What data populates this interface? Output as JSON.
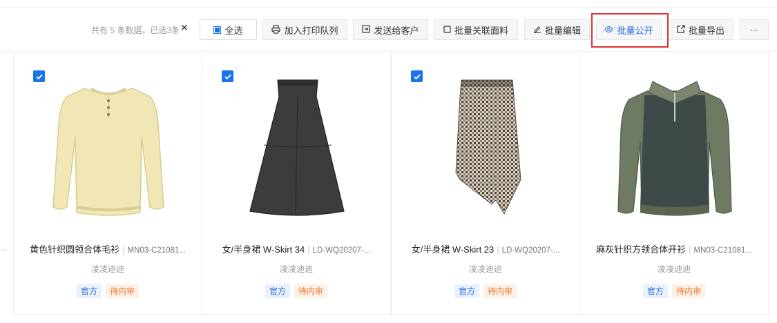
{
  "toolbar": {
    "count_text": "共有 5 条数据，已选3条",
    "clear_icon": "✕",
    "select_all": "全选",
    "add_print": "加入打印队列",
    "send_customer": "发送给客户",
    "batch_link_fabric": "批量关联面料",
    "batch_edit": "批量编辑",
    "batch_publish": "批量公开",
    "batch_export": "批量导出",
    "more": "···"
  },
  "colors": {
    "accent": "#1a73e8",
    "highlight_border": "#e0302f",
    "tag_blue_text": "#2a6be0",
    "tag_orange_text": "#f07a30"
  },
  "left_stub": {
    "dots": "..."
  },
  "cards": [
    {
      "name": "黄色针织圆领合体毛衫",
      "code": "MN03-C21081...",
      "owner": "凌凌迪迪",
      "tag1": "官方",
      "tag2": "待内审",
      "checked": true,
      "image": "yellow-sweater"
    },
    {
      "name": "女/半身裙 W-Skirt 34",
      "code": "LD-WQ20207-...",
      "owner": "凌凌迪迪",
      "tag1": "官方",
      "tag2": "待内审",
      "checked": true,
      "image": "black-skirt"
    },
    {
      "name": "女/半身裙 W-Skirt 23",
      "code": "LD-WQ20207-...",
      "owner": "凌凌迪迪",
      "tag1": "官方",
      "tag2": "待内审",
      "checked": true,
      "image": "plaid-skirt"
    },
    {
      "name": "麻灰针织方领合体开衫",
      "code": "MN03-C21081...",
      "owner": "凌凌迪迪",
      "tag1": "官方",
      "tag2": "待内审",
      "checked": false,
      "image": "grey-polo-sweater"
    }
  ]
}
